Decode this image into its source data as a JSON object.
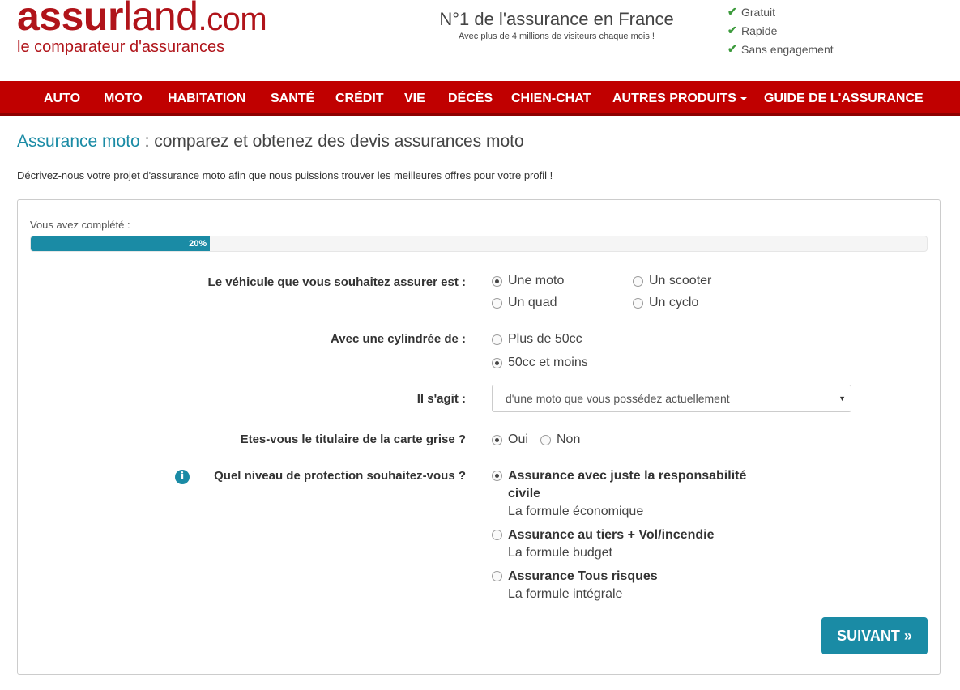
{
  "header": {
    "logo_assur": "assur",
    "logo_land": "land",
    "logo_com": ".com",
    "logo_tagline": "le comparateur d'assurances",
    "tagline_main": "N°1 de l'assurance en France",
    "tagline_sub": "Avec plus de 4 millions de visiteurs chaque mois !",
    "benefits": [
      "Gratuit",
      "Rapide",
      "Sans engagement"
    ]
  },
  "nav": {
    "items": [
      "AUTO",
      "MOTO",
      "HABITATION",
      "SANTÉ",
      "CRÉDIT",
      "VIE",
      "DÉCÈS",
      "CHIEN-CHAT",
      "AUTRES PRODUITS",
      "GUIDE DE L'ASSURANCE"
    ]
  },
  "page": {
    "title_accent": "Assurance moto",
    "title_rest": " : comparez et obtenez des devis assurances moto",
    "intro": "Décrivez-nous votre projet d'assurance moto afin que nous puissions trouver les meilleures offres pour votre profil !"
  },
  "progress": {
    "label": "Vous avez complété :",
    "value_text": "20%",
    "value": 20
  },
  "form": {
    "vehicle": {
      "label": "Le véhicule que vous souhaitez assurer est :",
      "options": [
        "Une moto",
        "Un scooter",
        "Un quad",
        "Un cyclo"
      ],
      "selected": "Une moto"
    },
    "cylinder": {
      "label": "Avec une cylindrée de :",
      "options": [
        "Plus de 50cc",
        "50cc et moins"
      ],
      "selected": "50cc et moins"
    },
    "ownership": {
      "label": "Il s'agit :",
      "selected_value": "d'une moto que vous possédez actuellement"
    },
    "holder": {
      "label": "Etes-vous le titulaire de la carte grise ?",
      "options": [
        "Oui",
        "Non"
      ],
      "selected": "Oui"
    },
    "protection": {
      "label": "Quel niveau de protection souhaitez-vous ?",
      "info_icon": "i",
      "options": [
        {
          "title_line1": "Assurance avec juste la responsabilité",
          "title_line2": "civile",
          "sub": "La formule économique"
        },
        {
          "title_line1": "Assurance au tiers + Vol/incendie",
          "sub": "La formule budget"
        },
        {
          "title_line1": "Assurance Tous risques",
          "sub": "La formule intégrale"
        }
      ],
      "selected_index": 0
    },
    "submit_label": "SUIVANT »"
  },
  "icons": {
    "check": "check-icon",
    "info": "info-icon",
    "caret": "caret-down-icon"
  },
  "colors": {
    "brand_red": "#c00000",
    "accent_teal": "#1a8ba5",
    "check_green": "#3c9a3c"
  }
}
